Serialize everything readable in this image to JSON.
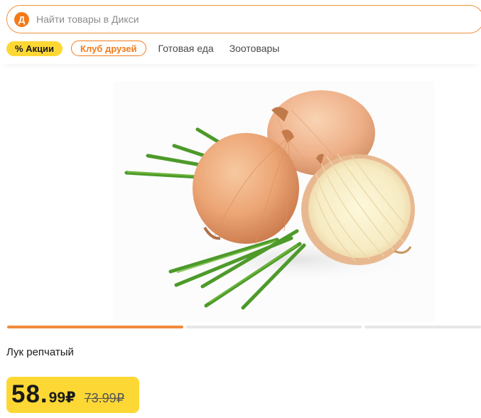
{
  "header": {
    "logo_letter": "Д",
    "search": {
      "placeholder": "Найти товары в Дикси",
      "value": ""
    },
    "chips": {
      "promo_label": "% Акции",
      "club_label": "Клуб друзей"
    },
    "nav": [
      "Готовая еда",
      "Зоотовары"
    ]
  },
  "gallery": {
    "image_subject": "onion-photo",
    "slides_total": 3,
    "active_slide": 1
  },
  "product": {
    "title": "Лук репчатый",
    "price": {
      "integer": "58.",
      "fraction": "99",
      "currency": "₽",
      "old": "73.99₽"
    }
  },
  "colors": {
    "brand_orange": "#f27a1a",
    "promo_yellow": "#fdd835"
  }
}
